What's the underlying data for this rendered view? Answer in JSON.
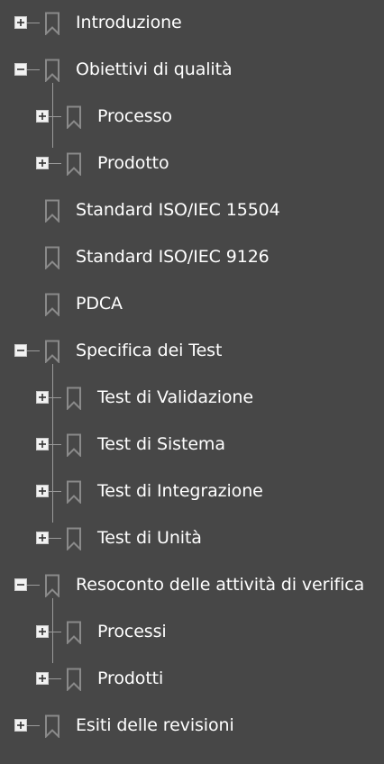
{
  "bookmarks": [
    {
      "label": "Introduzione",
      "toggle": "plus",
      "has_children": true
    },
    {
      "label": "Obiettivi di qualità",
      "toggle": "minus",
      "has_children": true
    },
    {
      "label": "Processo",
      "toggle": "plus",
      "has_children": true
    },
    {
      "label": "Prodotto",
      "toggle": "plus",
      "has_children": true
    },
    {
      "label": "Standard ISO/IEC 15504",
      "toggle": "none",
      "has_children": false
    },
    {
      "label": "Standard ISO/IEC 9126",
      "toggle": "none",
      "has_children": false
    },
    {
      "label": "PDCA",
      "toggle": "none",
      "has_children": false
    },
    {
      "label": "Specifica dei Test",
      "toggle": "minus",
      "has_children": true
    },
    {
      "label": "Test di Validazione",
      "toggle": "plus",
      "has_children": true
    },
    {
      "label": "Test di Sistema",
      "toggle": "plus",
      "has_children": true
    },
    {
      "label": "Test di Integrazione",
      "toggle": "plus",
      "has_children": true
    },
    {
      "label": "Test di Unità",
      "toggle": "plus",
      "has_children": true
    },
    {
      "label": "Resoconto delle attività di verifica",
      "toggle": "minus",
      "has_children": true
    },
    {
      "label": "Processi",
      "toggle": "plus",
      "has_children": true
    },
    {
      "label": "Prodotti",
      "toggle": "plus",
      "has_children": true
    },
    {
      "label": "Esiti delle revisioni",
      "toggle": "plus",
      "has_children": true
    }
  ],
  "colors": {
    "panel_background": "#474747",
    "label_text": "#ffffff",
    "bookmark_icon": "#8a8a8a",
    "connector_lines": "#9a9a9a",
    "toggle_border": "#c8c8c8",
    "toggle_fill": "#f2f2f2",
    "toggle_glyph": "#333333"
  },
  "icons": {
    "expand": "plus-box-icon",
    "collapse": "minus-box-icon",
    "bookmark": "bookmark-icon"
  }
}
